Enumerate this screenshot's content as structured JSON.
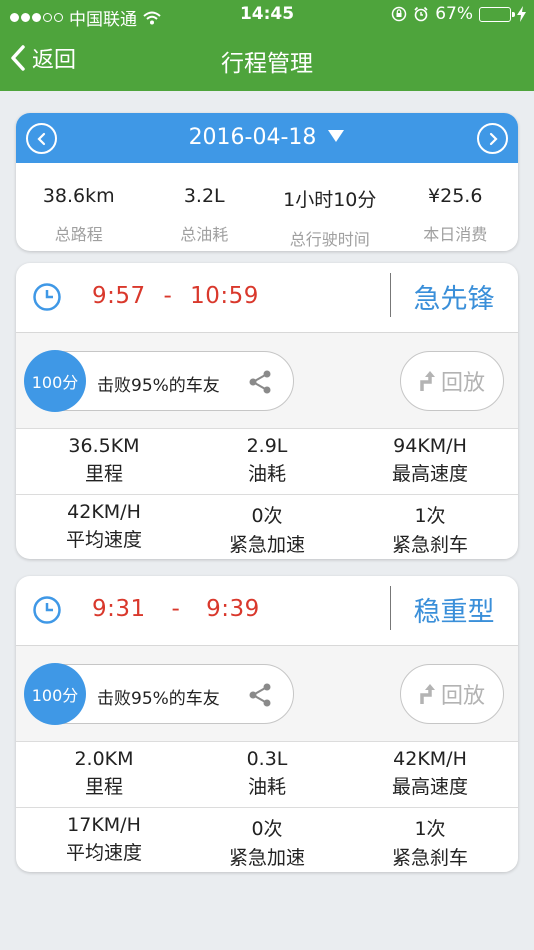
{
  "status": {
    "carrier": "中国联通",
    "time": "14:45",
    "battery": "67%",
    "battery_level": 0.67
  },
  "nav": {
    "back_label": "返回",
    "title": "行程管理"
  },
  "summary": {
    "date": "2016-04-18",
    "stats": [
      {
        "value": "38.6km",
        "label": "总路程"
      },
      {
        "value": "3.2L",
        "label": "总油耗"
      },
      {
        "value": "1小时10分",
        "label": "总行驶时间"
      },
      {
        "value": "¥25.6",
        "label": "本日消费"
      }
    ]
  },
  "trips": [
    {
      "start": "9:57",
      "sep": "-",
      "end": "10:59",
      "type": "急先锋",
      "score": "100分",
      "score_text": "击败95%的车友",
      "replay_label": "回放",
      "stats": [
        {
          "value": "36.5KM",
          "label": "里程"
        },
        {
          "value": "2.9L",
          "label": "油耗"
        },
        {
          "value": "94KM/H",
          "label": "最高速度"
        },
        {
          "value": "42KM/H",
          "label": "平均速度"
        },
        {
          "value": "0次",
          "label": "紧急加速"
        },
        {
          "value": "1次",
          "label": "紧急刹车"
        }
      ]
    },
    {
      "start": "9:31",
      "sep": "-",
      "end": "9:39",
      "type": "稳重型",
      "score": "100分",
      "score_text": "击败95%的车友",
      "replay_label": "回放",
      "stats": [
        {
          "value": "2.0KM",
          "label": "里程"
        },
        {
          "value": "0.3L",
          "label": "油耗"
        },
        {
          "value": "42KM/H",
          "label": "最高速度"
        },
        {
          "value": "17KM/H",
          "label": "平均速度"
        },
        {
          "value": "0次",
          "label": "紧急加速"
        },
        {
          "value": "1次",
          "label": "紧急刹车"
        }
      ]
    }
  ],
  "colors": {
    "header_green": "#4ea43c",
    "accent_blue": "#3f98e6",
    "time_red": "#d9382c",
    "type_blue": "#3a8fd9"
  }
}
